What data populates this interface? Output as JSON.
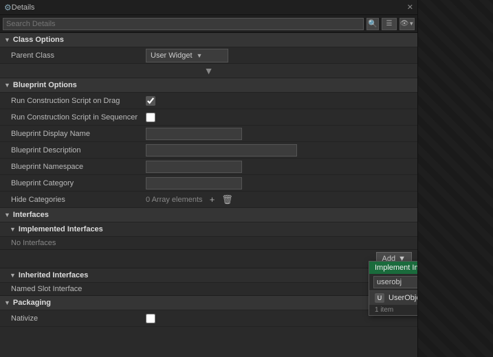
{
  "titleBar": {
    "title": "Details",
    "closeLabel": "✕"
  },
  "searchBar": {
    "placeholder": "Search Details",
    "searchIconLabel": "🔍",
    "viewIconLabel": "☰",
    "eyeIconLabel": "👁"
  },
  "classOptions": {
    "sectionLabel": "Class Options",
    "parentClassLabel": "Parent Class",
    "parentClassValue": "User Widget"
  },
  "blueprintOptions": {
    "sectionLabel": "Blueprint Options",
    "runConstructionOnDragLabel": "Run Construction Script on Drag",
    "runConstructionOnDragChecked": true,
    "runConstructionInSequencerLabel": "Run Construction Script in Sequencer",
    "runConstructionInSequencerChecked": false,
    "displayNameLabel": "Blueprint Display Name",
    "displayNameValue": "",
    "descriptionLabel": "Blueprint Description",
    "descriptionValue": "",
    "namespaceLabel": "Blueprint Namespace",
    "namespaceValue": "",
    "categoryLabel": "Blueprint Category",
    "categoryValue": "",
    "hideCategoriesLabel": "Hide Categories",
    "hideCategoriesValue": "0 Array elements",
    "addLabel": "+",
    "deleteLabel": "🗑"
  },
  "interfaces": {
    "sectionLabel": "Interfaces",
    "implementedLabel": "Implemented Interfaces",
    "noInterfacesLabel": "No Interfaces",
    "inheritedLabel": "Inherited Interfaces",
    "namedSlotLabel": "Named Slot Interface"
  },
  "addButton": {
    "label": "Add",
    "arrowLabel": "▼"
  },
  "implementInterfacePopup": {
    "headerLabel": "Implement Interface",
    "searchValue": "userobj",
    "item": {
      "iconLabel": "U",
      "label": "UserObjectListEntry"
    },
    "countLabel": "1 item"
  },
  "packaging": {
    "sectionLabel": "Packaging",
    "nativizeLabel": "Nativize",
    "nativizeChecked": false
  }
}
